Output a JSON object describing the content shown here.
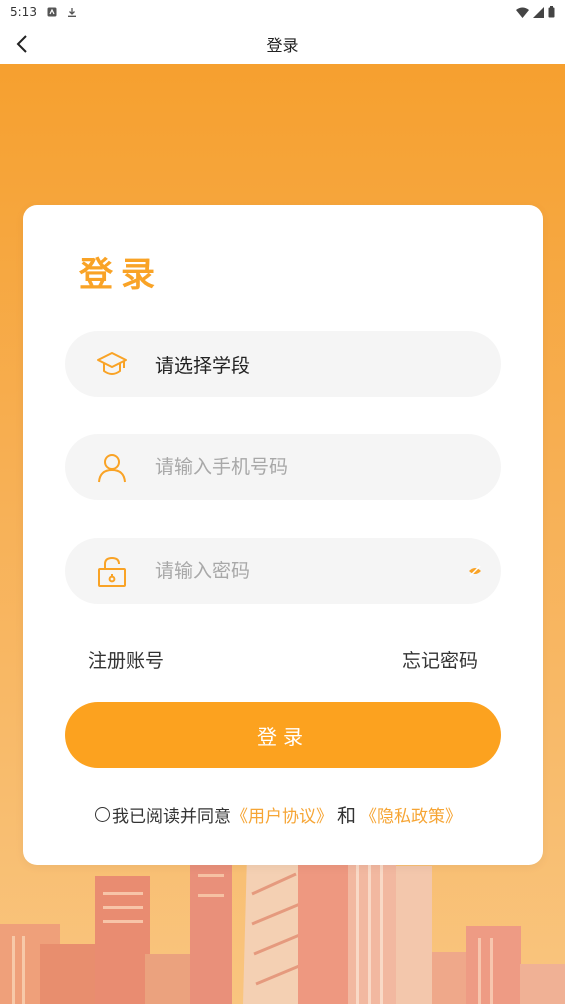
{
  "status_bar": {
    "time": "5:13"
  },
  "nav": {
    "title": "登录"
  },
  "card": {
    "title": "登录",
    "stage_select": {
      "label": "请选择学段"
    },
    "phone_input": {
      "placeholder": "请输入手机号码"
    },
    "password_input": {
      "placeholder": "请输入密码"
    },
    "register_link": "注册账号",
    "forgot_link": "忘记密码",
    "login_button": "登录",
    "agreement": {
      "prefix": "我已阅读并同意",
      "user_agreement": "《用户协议》",
      "and": "和",
      "privacy_policy": "《隐私政策》"
    }
  },
  "colors": {
    "accent": "#F9A326",
    "button": "#FCA21F",
    "link": "#F6A535"
  },
  "icons": [
    "back-arrow-icon",
    "graduation-cap-icon",
    "user-icon",
    "lock-icon",
    "eye-icon"
  ]
}
